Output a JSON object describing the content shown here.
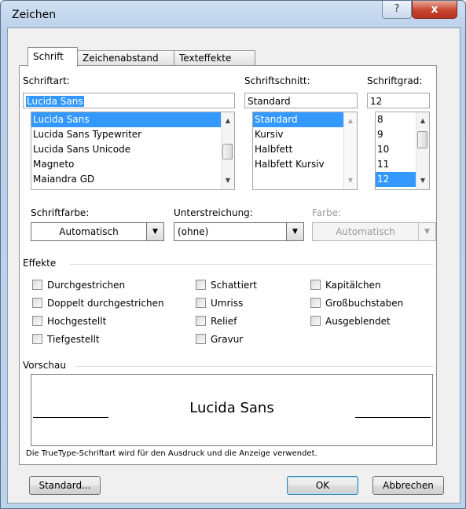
{
  "window": {
    "title": "Zeichen",
    "help_label": "?",
    "close_label": "x"
  },
  "tabs": [
    {
      "label": "Schrift"
    },
    {
      "label": "Zeichenabstand"
    },
    {
      "label": "Texteffekte"
    }
  ],
  "font": {
    "label": "Schriftart:",
    "value": "Lucida Sans",
    "items": [
      "Lucida Sans",
      "Lucida Sans Typewriter",
      "Lucida Sans Unicode",
      "Magneto",
      "Maiandra GD"
    ],
    "selected_index": 0
  },
  "style": {
    "label": "Schriftschnitt:",
    "value": "Standard",
    "items": [
      "Standard",
      "Kursiv",
      "Halbfett",
      "Halbfett Kursiv"
    ],
    "selected_index": 0
  },
  "size": {
    "label": "Schriftgrad:",
    "value": "12",
    "items": [
      "8",
      "9",
      "10",
      "11",
      "12"
    ],
    "selected_index": 4
  },
  "font_color": {
    "label": "Schriftfarbe:",
    "value": "Automatisch"
  },
  "underline": {
    "label": "Unterstreichung:",
    "value": "(ohne)"
  },
  "underline_color": {
    "label": "Farbe:",
    "value": "Automatisch"
  },
  "effects": {
    "label": "Effekte",
    "col1": [
      "Durchgestrichen",
      "Doppelt durchgestrichen",
      "Hochgestellt",
      "Tiefgestellt"
    ],
    "col2": [
      "Schattiert",
      "Umriss",
      "Relief",
      "Gravur"
    ],
    "col3": [
      "Kapitälchen",
      "Großbuchstaben",
      "Ausgeblendet"
    ]
  },
  "preview": {
    "label": "Vorschau",
    "text": "Lucida Sans",
    "note": "Die TrueType-Schriftart wird für den Ausdruck und die Anzeige verwendet."
  },
  "buttons": {
    "default": "Standard...",
    "ok": "OK",
    "cancel": "Abbrechen"
  },
  "colors": {
    "selection": "#3399ff",
    "close_button": "#c7452f",
    "title_gradient": "#cfe0f2"
  }
}
